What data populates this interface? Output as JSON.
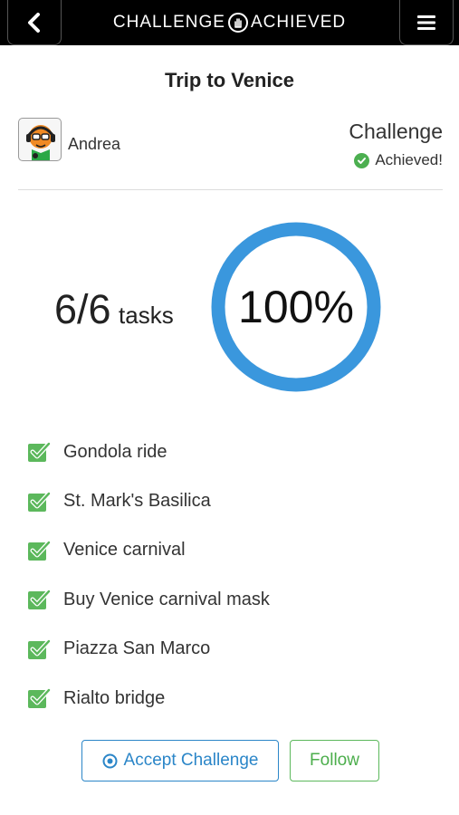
{
  "header": {
    "brand_left": "CHALLENGE",
    "brand_right": "ACHIEVED",
    "back_icon": "chevron-left-icon",
    "menu_icon": "hamburger-menu-icon",
    "background": "#000000"
  },
  "challenge": {
    "title": "Trip to Venice",
    "user": {
      "name": "Andrea",
      "avatar": "avatar-icon"
    },
    "status_label": "Challenge",
    "status_value": "Achieved!",
    "status_color": "#4caf50"
  },
  "progress": {
    "count": "6/6",
    "unit": "tasks",
    "percent_label": "100%",
    "fraction": 1.0,
    "ring_color": "#3a97dd"
  },
  "tasks": [
    {
      "label": "Gondola ride",
      "done": true
    },
    {
      "label": "St. Mark's Basilica",
      "done": true
    },
    {
      "label": "Venice carnival",
      "done": true
    },
    {
      "label": "Buy Venice carnival mask",
      "done": true
    },
    {
      "label": "Piazza San Marco",
      "done": true
    },
    {
      "label": "Rialto bridge",
      "done": true
    }
  ],
  "actions": {
    "accept_label": "Accept Challenge",
    "accept_color": "#2b86c8",
    "follow_label": "Follow",
    "follow_color": "#5cb85c"
  }
}
